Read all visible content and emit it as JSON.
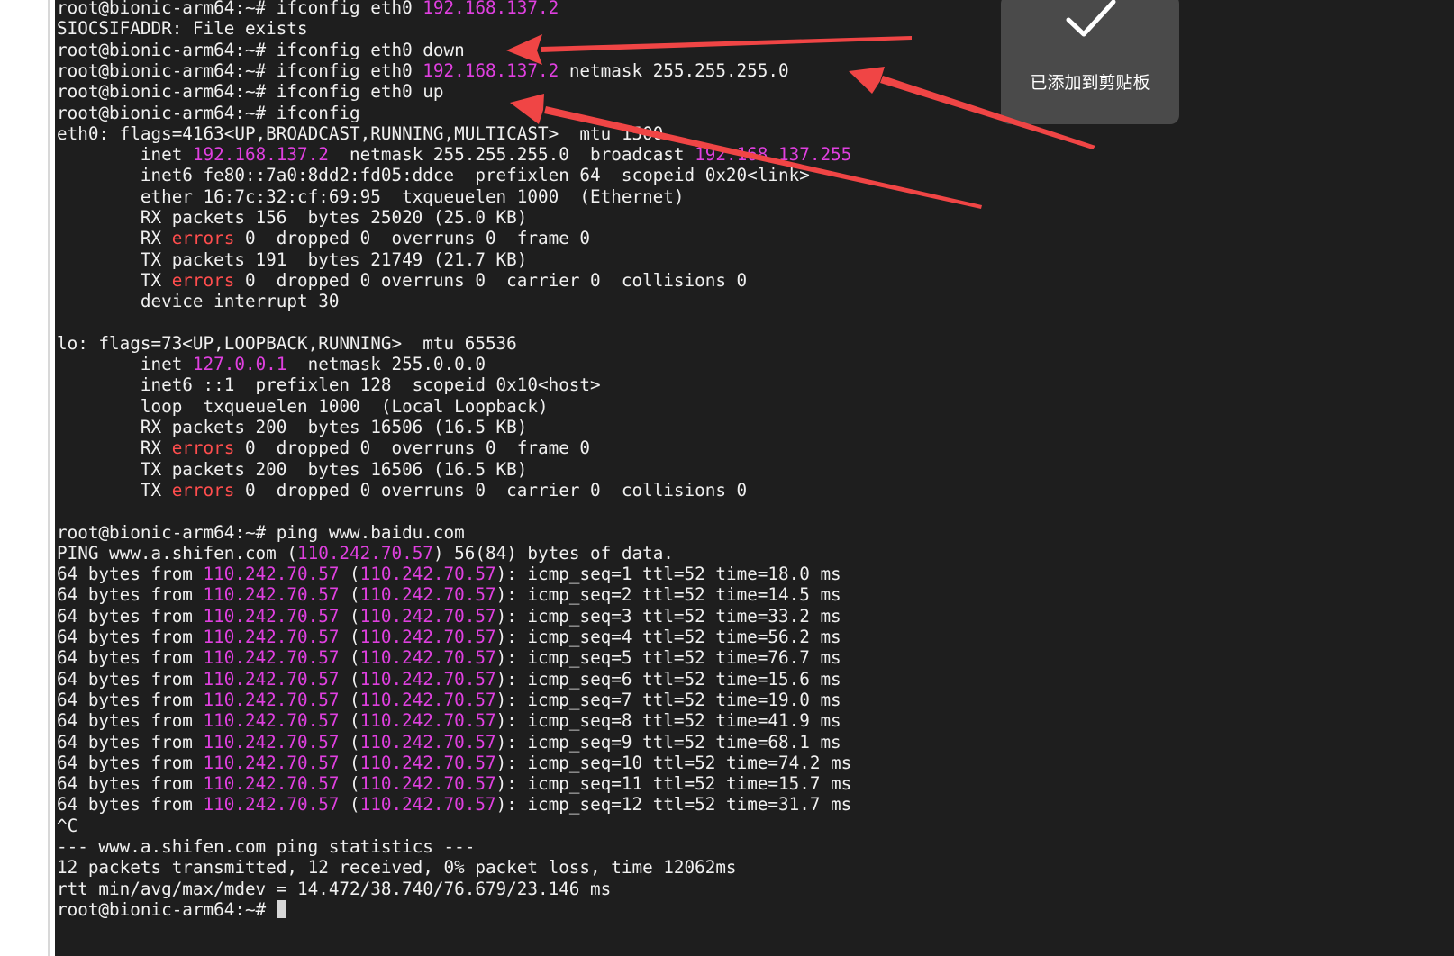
{
  "terminal": {
    "lines": [
      [
        {
          "t": "root@bionic-arm64:~# ifconfig eth0 "
        },
        {
          "t": "192.168.137.2",
          "c": "ip"
        }
      ],
      [
        {
          "t": "SIOCSIFADDR: File exists"
        }
      ],
      [
        {
          "t": "root@bionic-arm64:~# ifconfig eth0 down"
        }
      ],
      [
        {
          "t": "root@bionic-arm64:~# ifconfig eth0 "
        },
        {
          "t": "192.168.137.2",
          "c": "ip"
        },
        {
          "t": " netmask 255.255.255.0"
        }
      ],
      [
        {
          "t": "root@bionic-arm64:~# ifconfig eth0 up"
        }
      ],
      [
        {
          "t": "root@bionic-arm64:~# ifconfig"
        }
      ],
      [
        {
          "t": "eth0: flags=4163<UP,BROADCAST,RUNNING,MULTICAST>  mtu 1500"
        }
      ],
      [
        {
          "t": "        inet "
        },
        {
          "t": "192.168.137.2",
          "c": "ip"
        },
        {
          "t": "  netmask 255.255.255.0  broadcast "
        },
        {
          "t": "192.168.137.255",
          "c": "ip"
        }
      ],
      [
        {
          "t": "        inet6 fe80::7a0:8dd2:fd05:ddce  prefixlen 64  scopeid 0x20<link>"
        }
      ],
      [
        {
          "t": "        ether 16:7c:32:cf:69:95  txqueuelen 1000  (Ethernet)"
        }
      ],
      [
        {
          "t": "        RX packets 156  bytes 25020 (25.0 KB)"
        }
      ],
      [
        {
          "t": "        RX "
        },
        {
          "t": "errors",
          "c": "err"
        },
        {
          "t": " 0  dropped 0  overruns 0  frame 0"
        }
      ],
      [
        {
          "t": "        TX packets 191  bytes 21749 (21.7 KB)"
        }
      ],
      [
        {
          "t": "        TX "
        },
        {
          "t": "errors",
          "c": "err"
        },
        {
          "t": " 0  dropped 0 overruns 0  carrier 0  collisions 0"
        }
      ],
      [
        {
          "t": "        device interrupt 30"
        }
      ],
      [],
      [
        {
          "t": "lo: flags=73<UP,LOOPBACK,RUNNING>  mtu 65536"
        }
      ],
      [
        {
          "t": "        inet "
        },
        {
          "t": "127.0.0.1",
          "c": "ip"
        },
        {
          "t": "  netmask 255.0.0.0"
        }
      ],
      [
        {
          "t": "        inet6 ::1  prefixlen 128  scopeid 0x10<host>"
        }
      ],
      [
        {
          "t": "        loop  txqueuelen 1000  (Local Loopback)"
        }
      ],
      [
        {
          "t": "        RX packets 200  bytes 16506 (16.5 KB)"
        }
      ],
      [
        {
          "t": "        RX "
        },
        {
          "t": "errors",
          "c": "err"
        },
        {
          "t": " 0  dropped 0  overruns 0  frame 0"
        }
      ],
      [
        {
          "t": "        TX packets 200  bytes 16506 (16.5 KB)"
        }
      ],
      [
        {
          "t": "        TX "
        },
        {
          "t": "errors",
          "c": "err"
        },
        {
          "t": " 0  dropped 0 overruns 0  carrier 0  collisions 0"
        }
      ],
      [],
      [
        {
          "t": "root@bionic-arm64:~# ping www.baidu.com"
        }
      ],
      [
        {
          "t": "PING www.a.shifen.com ("
        },
        {
          "t": "110.242.70.57",
          "c": "ip"
        },
        {
          "t": ") 56(84) bytes of data."
        }
      ],
      [
        {
          "t": "64 bytes from "
        },
        {
          "t": "110.242.70.57",
          "c": "ip"
        },
        {
          "t": " ("
        },
        {
          "t": "110.242.70.57",
          "c": "ip"
        },
        {
          "t": "): icmp_seq=1 ttl=52 time=18.0 ms"
        }
      ],
      [
        {
          "t": "64 bytes from "
        },
        {
          "t": "110.242.70.57",
          "c": "ip"
        },
        {
          "t": " ("
        },
        {
          "t": "110.242.70.57",
          "c": "ip"
        },
        {
          "t": "): icmp_seq=2 ttl=52 time=14.5 ms"
        }
      ],
      [
        {
          "t": "64 bytes from "
        },
        {
          "t": "110.242.70.57",
          "c": "ip"
        },
        {
          "t": " ("
        },
        {
          "t": "110.242.70.57",
          "c": "ip"
        },
        {
          "t": "): icmp_seq=3 ttl=52 time=33.2 ms"
        }
      ],
      [
        {
          "t": "64 bytes from "
        },
        {
          "t": "110.242.70.57",
          "c": "ip"
        },
        {
          "t": " ("
        },
        {
          "t": "110.242.70.57",
          "c": "ip"
        },
        {
          "t": "): icmp_seq=4 ttl=52 time=56.2 ms"
        }
      ],
      [
        {
          "t": "64 bytes from "
        },
        {
          "t": "110.242.70.57",
          "c": "ip"
        },
        {
          "t": " ("
        },
        {
          "t": "110.242.70.57",
          "c": "ip"
        },
        {
          "t": "): icmp_seq=5 ttl=52 time=76.7 ms"
        }
      ],
      [
        {
          "t": "64 bytes from "
        },
        {
          "t": "110.242.70.57",
          "c": "ip"
        },
        {
          "t": " ("
        },
        {
          "t": "110.242.70.57",
          "c": "ip"
        },
        {
          "t": "): icmp_seq=6 ttl=52 time=15.6 ms"
        }
      ],
      [
        {
          "t": "64 bytes from "
        },
        {
          "t": "110.242.70.57",
          "c": "ip"
        },
        {
          "t": " ("
        },
        {
          "t": "110.242.70.57",
          "c": "ip"
        },
        {
          "t": "): icmp_seq=7 ttl=52 time=19.0 ms"
        }
      ],
      [
        {
          "t": "64 bytes from "
        },
        {
          "t": "110.242.70.57",
          "c": "ip"
        },
        {
          "t": " ("
        },
        {
          "t": "110.242.70.57",
          "c": "ip"
        },
        {
          "t": "): icmp_seq=8 ttl=52 time=41.9 ms"
        }
      ],
      [
        {
          "t": "64 bytes from "
        },
        {
          "t": "110.242.70.57",
          "c": "ip"
        },
        {
          "t": " ("
        },
        {
          "t": "110.242.70.57",
          "c": "ip"
        },
        {
          "t": "): icmp_seq=9 ttl=52 time=68.1 ms"
        }
      ],
      [
        {
          "t": "64 bytes from "
        },
        {
          "t": "110.242.70.57",
          "c": "ip"
        },
        {
          "t": " ("
        },
        {
          "t": "110.242.70.57",
          "c": "ip"
        },
        {
          "t": "): icmp_seq=10 ttl=52 time=74.2 ms"
        }
      ],
      [
        {
          "t": "64 bytes from "
        },
        {
          "t": "110.242.70.57",
          "c": "ip"
        },
        {
          "t": " ("
        },
        {
          "t": "110.242.70.57",
          "c": "ip"
        },
        {
          "t": "): icmp_seq=11 ttl=52 time=15.7 ms"
        }
      ],
      [
        {
          "t": "64 bytes from "
        },
        {
          "t": "110.242.70.57",
          "c": "ip"
        },
        {
          "t": " ("
        },
        {
          "t": "110.242.70.57",
          "c": "ip"
        },
        {
          "t": "): icmp_seq=12 ttl=52 time=31.7 ms"
        }
      ],
      [
        {
          "t": "^C"
        }
      ],
      [
        {
          "t": "--- www.a.shifen.com ping statistics ---"
        }
      ],
      [
        {
          "t": "12 packets transmitted, 12 received, 0% packet loss, time 12062ms"
        }
      ],
      [
        {
          "t": "rtt min/avg/max/mdev = 14.472/38.740/76.679/23.146 ms"
        }
      ],
      [
        {
          "t": "root@bionic-arm64:~# "
        }
      ]
    ]
  },
  "toast": {
    "icon": "checkmark-icon",
    "text": "已添加到剪贴板"
  },
  "annotations": {
    "icon": "arrow-icon",
    "arrow_color": "#f04545"
  },
  "colors": {
    "terminal_bg": "#1e1e1e",
    "text": "#f0f0f0",
    "ip_highlight": "#e040e0",
    "error_highlight": "#ff4d4d",
    "toast_bg": "#4a4a4a"
  }
}
